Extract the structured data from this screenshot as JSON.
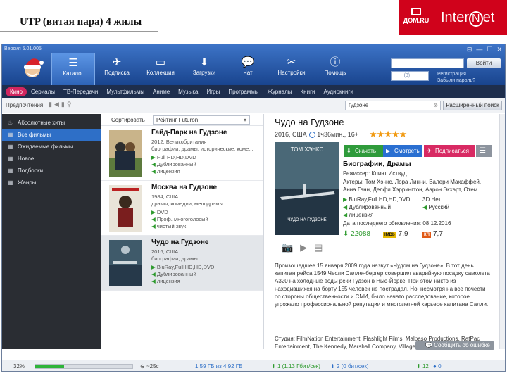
{
  "slide": {
    "title": "UTP (витая пара) 4 жилы"
  },
  "logos": {
    "domru": "ДОМ.RU",
    "inter_left": "Inter",
    "inter_ring": "N",
    "inter_right": "et"
  },
  "window": {
    "version": "Версия 5.01.005",
    "controls": [
      "⊟",
      "—",
      "☐",
      "✕"
    ]
  },
  "toolbar": [
    {
      "label": "Каталог",
      "icon": "list-icon",
      "glyph": "☰"
    },
    {
      "label": "Подписка",
      "icon": "paper-plane-icon",
      "glyph": "✈"
    },
    {
      "label": "Коллекция",
      "icon": "collection-icon",
      "glyph": "▭"
    },
    {
      "label": "Загрузки",
      "icon": "download-icon",
      "glyph": "⬇"
    },
    {
      "label": "Чат",
      "icon": "chat-icon",
      "glyph": "💬"
    },
    {
      "label": "Настройки",
      "icon": "tools-icon",
      "glyph": "✂"
    },
    {
      "label": "Помощь",
      "icon": "info-icon",
      "glyph": "ⓘ"
    }
  ],
  "login": {
    "button": "Войти",
    "mail_count": "(3)",
    "register": "Регистрация",
    "forgot": "Забыли пароль?"
  },
  "categories": [
    "Кино",
    "Сериалы",
    "ТВ-Передачи",
    "Мультфильмы",
    "Аниме",
    "Музыка",
    "Игры",
    "Программы",
    "Журналы",
    "Книги",
    "Аудиокниги"
  ],
  "prefs": {
    "label": "Предпочтения",
    "icons": "▮◀▮⚲",
    "search_value": "гудзоне",
    "search_clear": "⊗",
    "advanced": "Расширенный поиск"
  },
  "sidebar": [
    {
      "label": "Абсолютные хиты",
      "icon": "fire-icon",
      "glyph": "♨"
    },
    {
      "label": "Все фильмы",
      "icon": "film-icon",
      "glyph": "▦"
    },
    {
      "label": "Ожидаемые фильмы",
      "icon": "film-icon",
      "glyph": "▦"
    },
    {
      "label": "Новое",
      "icon": "film-icon",
      "glyph": "▦"
    },
    {
      "label": "Подборки",
      "icon": "film-icon",
      "glyph": "▦"
    },
    {
      "label": "Жанры",
      "icon": "film-icon",
      "glyph": "▦"
    }
  ],
  "sort": {
    "label": "Сортировать",
    "value": "Рейтинг Futuron",
    "caret": "▾"
  },
  "films": [
    {
      "title": "Гайд-Парк на Гудзоне",
      "year": "2012, Великобритания",
      "genres": "биографии, драмы, исторические, коме...",
      "quality": "Full HD,HD,DVD",
      "audio1": "Дублированный",
      "audio2": "лицензия"
    },
    {
      "title": "Москва на Гудзоне",
      "year": "1984, США",
      "genres": "драмы, комедии, мелодрамы",
      "quality": "DVD",
      "audio1": "Проф. многоголосый",
      "audio2": "чистый звук"
    },
    {
      "title": "Чудо на Гудзоне",
      "year": "2016, США",
      "genres": "биографии, драмы",
      "quality": "BluRay,Full HD,HD,DVD",
      "audio1": "Дублированный",
      "audio2": "лицензия"
    }
  ],
  "detail": {
    "title": "Чудо на Гудзоне",
    "meta": "2016, США",
    "duration": "1ч36мин., 16+",
    "stars": "★★★★★",
    "poster_actor": "ТОМ ХЭНКС",
    "poster_title": "ЧУДО НА ГУДЗОНЕ",
    "buttons": {
      "download": "Скачать",
      "watch": "Смотреть",
      "subscribe": "Подписаться",
      "menu": "☰"
    },
    "genre": "Биографии, Драмы",
    "director": "Режиссер: Клинт Иствуд",
    "actors1": "Актеры: Том Хэнкс, Лора Линни, Валери Махаффей,",
    "actors2": "Анна Ганн, Делфи Хэррингтон, Аарон Экхарт, Отем",
    "quality": "BluRay,Full HD,HD,DVD",
    "threed": "3D Нет",
    "audio": "Дублированный",
    "lang": "Русский",
    "license": "лицензия",
    "updated": "Дата последнего обновления: 08.12.2016",
    "downloads": "22088",
    "imdb_label": "IMDb",
    "imdb": "7,9",
    "kp_label": "КП",
    "kp": "7,7",
    "media_icons": "📷▶▤",
    "description": "Произошедшее 15 января 2009 года назвут «Чудом на Гудзоне». В тот день капитан рейса 1549 Чесли Салленбергер совершил аварийную посадку самолета A320 на холодные воды реки Гудзон в Нью-Йорке. При этом никто из находившихся на борту 155 человек не пострадал. Но, несмотря на все почести со стороны общественности и СМИ, было начато расследование, которое угрожало профессиональной репутации и многолетней карьере капитана Салли.",
    "studio": "Студия: FilmNation Entertainment, Flashlight Films, Malpaso Productions, RatPac Entertainment, The Kennedy, Marshall Company, Village Roadshow",
    "feedback": "Сообщить об ошибке"
  },
  "status": {
    "percent": "32%",
    "progress": 0.3,
    "time": "~25с",
    "size": "1.59 ГБ из 4.92 ГБ",
    "down": "1 (1.13 Гбит/сек)",
    "up": "2 (0 бит/сек)",
    "seeds": "12",
    "peers": "0"
  },
  "colors": {
    "accent": "#2e6fc7",
    "category_active": "#d2265f",
    "download": "#2f9b3b",
    "stars": "#f19a12"
  }
}
